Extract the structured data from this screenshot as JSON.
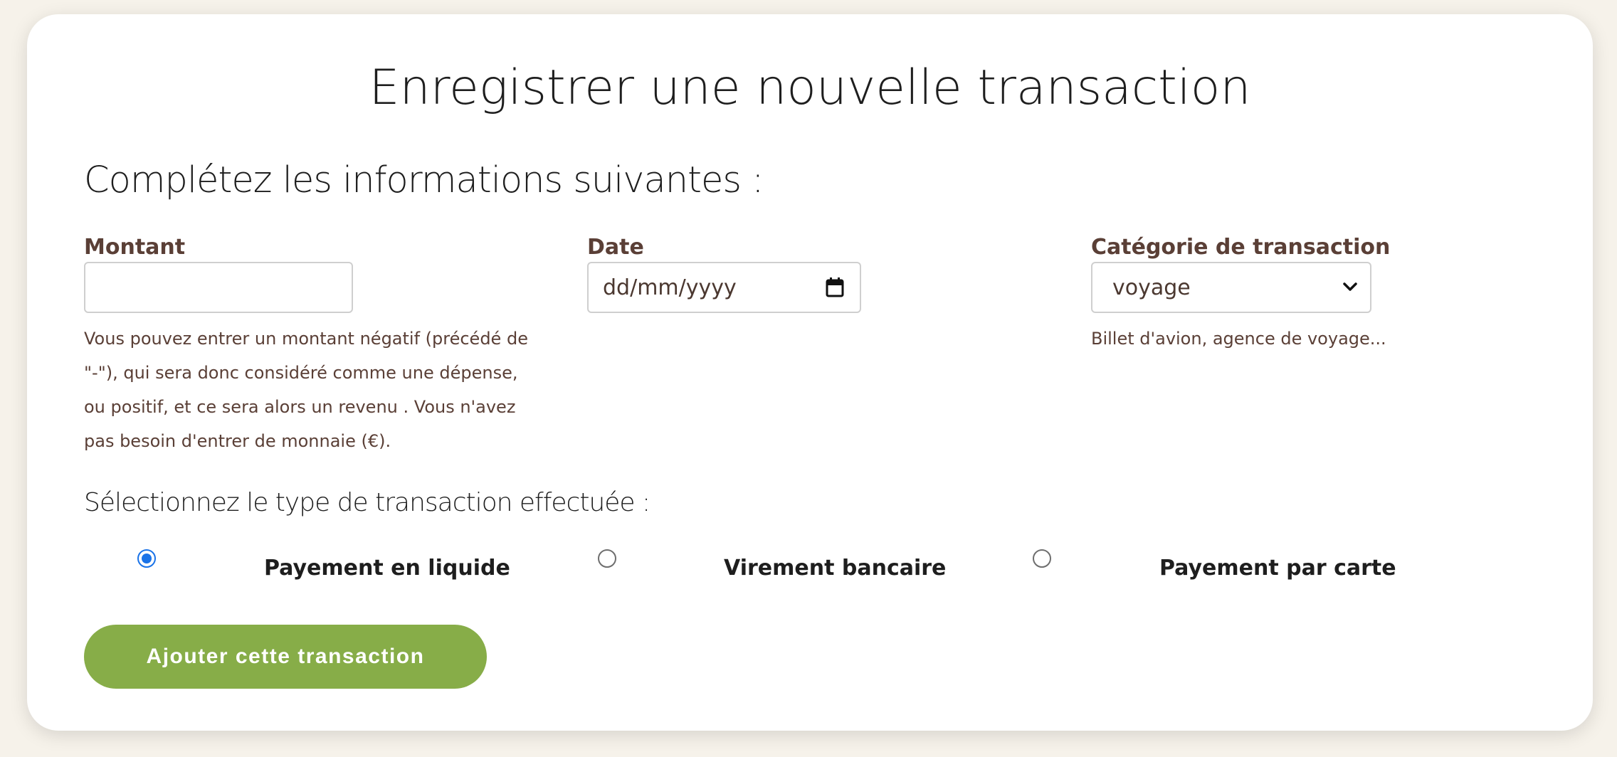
{
  "page": {
    "title": "Enregistrer une nouvelle transaction",
    "subtitle": "Complétez les informations suivantes :"
  },
  "form": {
    "amount": {
      "label": "Montant",
      "value": "",
      "hint_lines": [
        "Vous pouvez entrer un montant négatif (précédé de",
        "\"-\"), qui sera donc considéré comme une dépense,",
        "ou positif, et ce sera alors un revenu . Vous n'avez",
        "pas besoin d'entrer de monnaie (€)."
      ]
    },
    "date": {
      "label": "Date",
      "placeholder": "dd/mm/yyyy",
      "icon": "calendar-icon"
    },
    "category": {
      "label": "Catégorie de transaction",
      "selected": "voyage",
      "icon": "chevron-down-icon",
      "hint": "Billet d'avion, agence de voyage..."
    },
    "transaction_type": {
      "heading": "Sélectionnez le type de transaction effectuée :",
      "options": [
        {
          "label": "Payement en liquide",
          "checked": true
        },
        {
          "label": "Virement bancaire",
          "checked": false
        },
        {
          "label": "Payement par carte",
          "checked": false
        }
      ]
    },
    "submit_label": "Ajouter cette transaction"
  },
  "colors": {
    "background": "#f6f2ea",
    "card": "#ffffff",
    "label_brown": "#5a3f36",
    "button_green": "#87ad48",
    "radio_blue": "#1a73e8"
  }
}
